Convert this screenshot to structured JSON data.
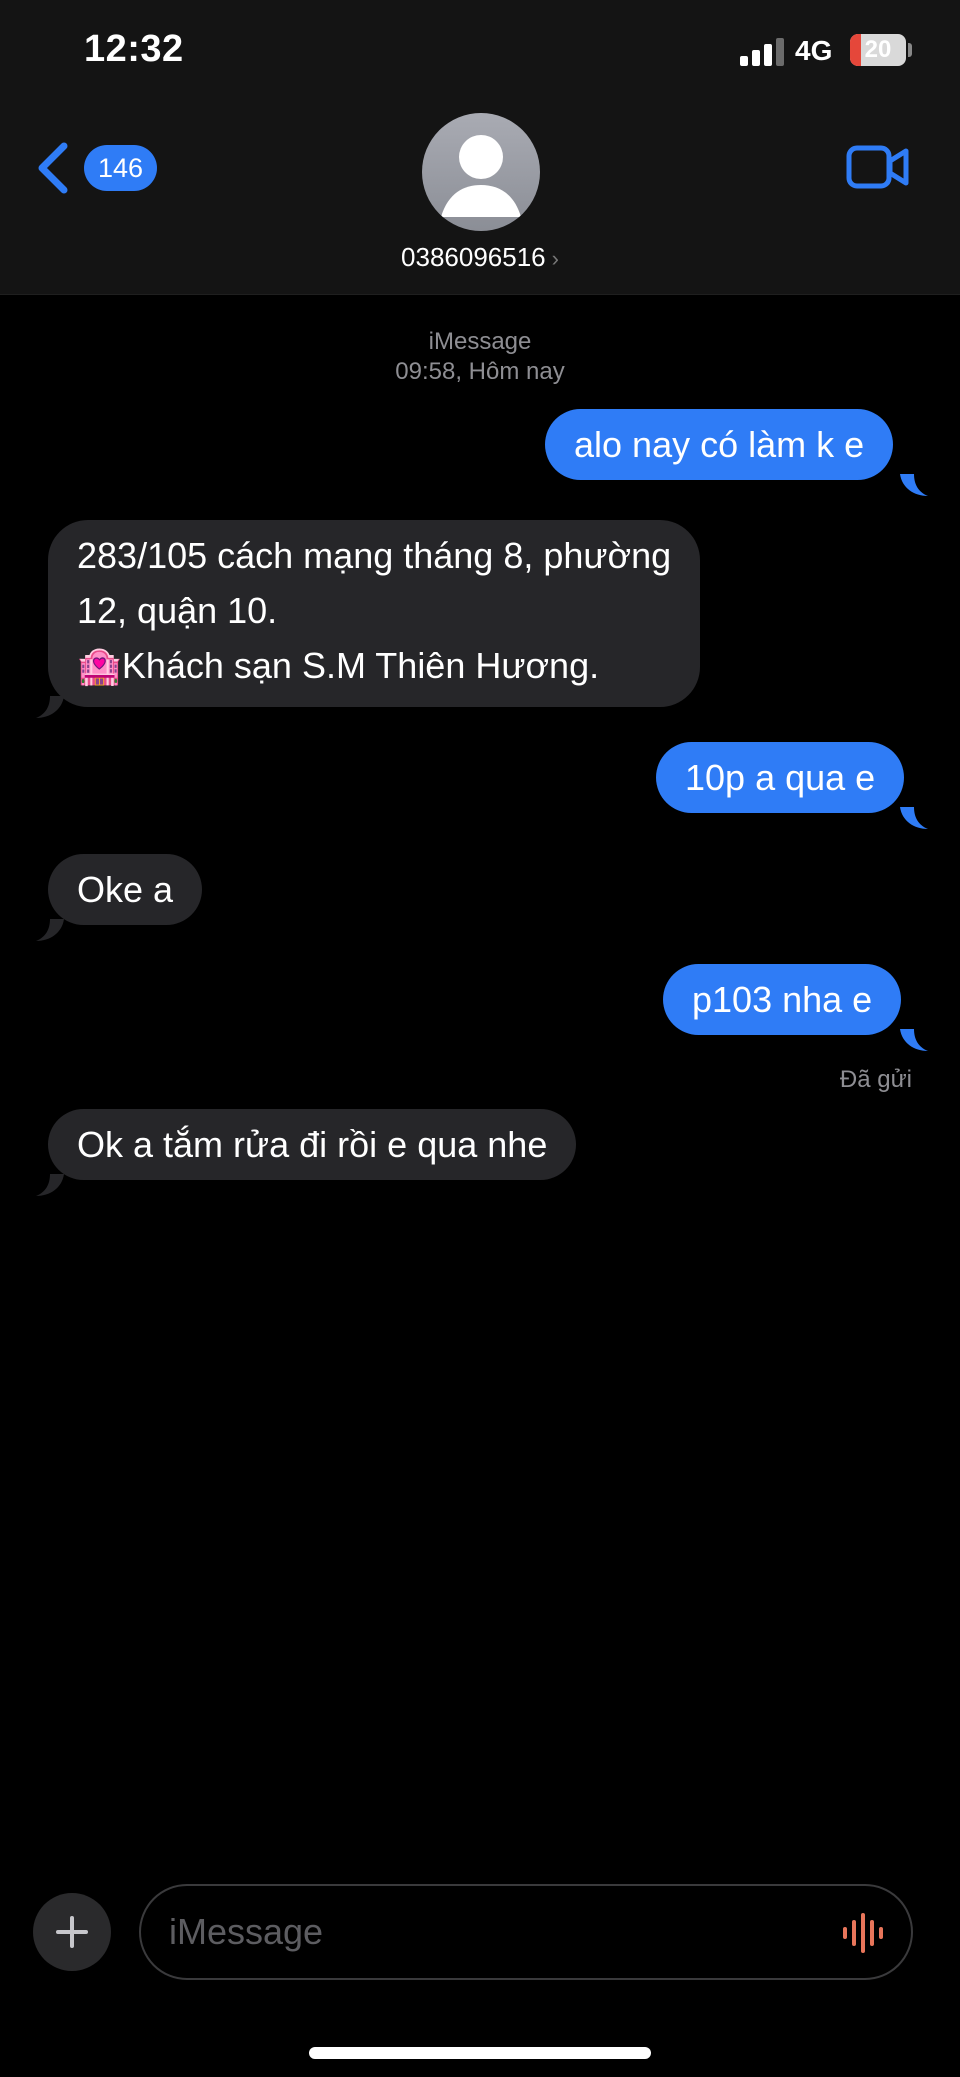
{
  "status_bar": {
    "time": "12:32",
    "network": "4G",
    "battery_level": "20",
    "battery_fraction": 0.2
  },
  "header": {
    "back_count": "146",
    "contact": "0386096516",
    "contact_chevron": "›",
    "accent_color": "#2f7cf6"
  },
  "conversation": {
    "service": "iMessage",
    "timestamp": "09:58, Hôm nay",
    "messages": [
      {
        "type": "sent",
        "lines": [
          "alo nay có làm k e"
        ]
      },
      {
        "type": "received",
        "lines": [
          "283/105 cách mạng tháng 8, phường",
          "12, quận 10.",
          "🏩Khách sạn S.M Thiên Hương."
        ]
      },
      {
        "type": "sent",
        "lines": [
          "10p a qua e"
        ]
      },
      {
        "type": "received",
        "lines": [
          "Oke a"
        ]
      },
      {
        "type": "sent",
        "lines": [
          "p103 nha e"
        ]
      },
      {
        "type": "received",
        "lines": [
          "Ok a tắm rửa đi rồi e qua nhe"
        ]
      }
    ],
    "delivered_label": "Đã gửi"
  },
  "composer": {
    "placeholder": "iMessage",
    "plus_icon": "plus-icon",
    "mic_icon": "waveform-icon"
  }
}
